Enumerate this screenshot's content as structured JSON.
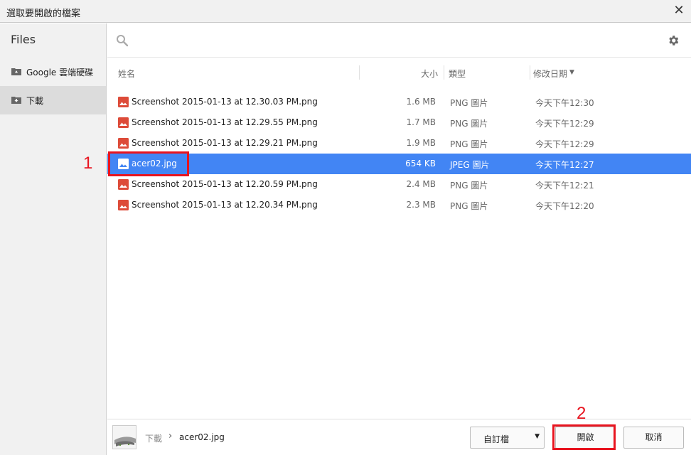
{
  "window": {
    "title": "選取要開啟的檔案"
  },
  "sidebar": {
    "app_name": "Files",
    "items": [
      {
        "label": "Google 雲端硬碟",
        "icon": "drive-icon",
        "selected": false
      },
      {
        "label": "下載",
        "icon": "downloads-folder-icon",
        "selected": true
      }
    ]
  },
  "columns": {
    "name": "姓名",
    "size": "大小",
    "type": "類型",
    "date": "修改日期"
  },
  "files": [
    {
      "name": "Screenshot 2015-01-13 at 12.30.03 PM.png",
      "size": "1.6 MB",
      "type": "PNG 圖片",
      "date": "今天下午12:30",
      "selected": false
    },
    {
      "name": "Screenshot 2015-01-13 at 12.29.55 PM.png",
      "size": "1.7 MB",
      "type": "PNG 圖片",
      "date": "今天下午12:29",
      "selected": false
    },
    {
      "name": "Screenshot 2015-01-13 at 12.29.21 PM.png",
      "size": "1.9 MB",
      "type": "PNG 圖片",
      "date": "今天下午12:29",
      "selected": false
    },
    {
      "name": "acer02.jpg",
      "size": "654 KB",
      "type": "JPEG 圖片",
      "date": "今天下午12:27",
      "selected": true
    },
    {
      "name": "Screenshot 2015-01-13 at 12.20.59 PM.png",
      "size": "2.4 MB",
      "type": "PNG 圖片",
      "date": "今天下午12:21",
      "selected": false
    },
    {
      "name": "Screenshot 2015-01-13 at 12.20.34 PM.png",
      "size": "2.3 MB",
      "type": "PNG 圖片",
      "date": "今天下午12:20",
      "selected": false
    }
  ],
  "footer": {
    "breadcrumb_folder": "下載",
    "breadcrumb_sep": "›",
    "breadcrumb_file": "acer02.jpg",
    "filter_value": "自訂檔",
    "open_label": "開啟",
    "cancel_label": "取消"
  },
  "annotations": {
    "marker_1": "1",
    "marker_2": "2"
  },
  "colors": {
    "selection": "#4285f4",
    "annotation": "#e8141f",
    "image_icon": "#dd4b39"
  }
}
